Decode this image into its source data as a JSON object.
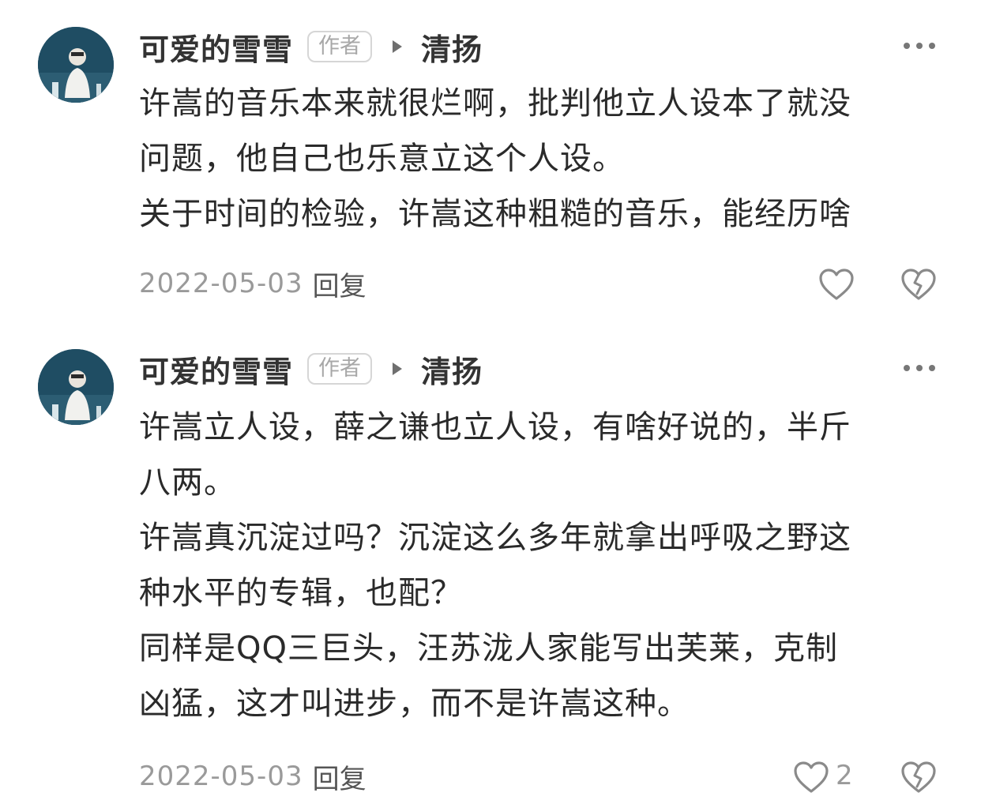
{
  "comments": [
    {
      "username": "可爱的雪雪",
      "badge": "作者",
      "reply_to": "清扬",
      "lines": [
        "许嵩的音乐本来就很烂啊，批判他立人设本了就没",
        "问题，他自己也乐意立这个人设。",
        "关于时间的检验，许嵩这种粗糙的音乐，能经历啥"
      ],
      "date": "2022-05-03",
      "reply_label": "回复",
      "like_count": ""
    },
    {
      "username": "可爱的雪雪",
      "badge": "作者",
      "reply_to": "清扬",
      "lines": [
        "许嵩立人设，薛之谦也立人设，有啥好说的，半斤",
        "八两。",
        "许嵩真沉淀过吗？沉淀这么多年就拿出呼吸之野这",
        "种水平的专辑，也配？",
        "同样是QQ三巨头，汪苏泷人家能写出芙莱，克制",
        "凶猛，这才叫进步，而不是许嵩这种。"
      ],
      "date": "2022-05-03",
      "reply_label": "回复",
      "like_count": "2"
    }
  ],
  "icons": {
    "more": "more-dots-icon",
    "like": "heart-icon",
    "dislike": "broken-heart-icon",
    "reply_arrow": "triangle-right-icon"
  },
  "colors": {
    "text": "#2a2a2a",
    "muted": "#9a9a9a",
    "avatar_bg": "#1f4d63"
  }
}
